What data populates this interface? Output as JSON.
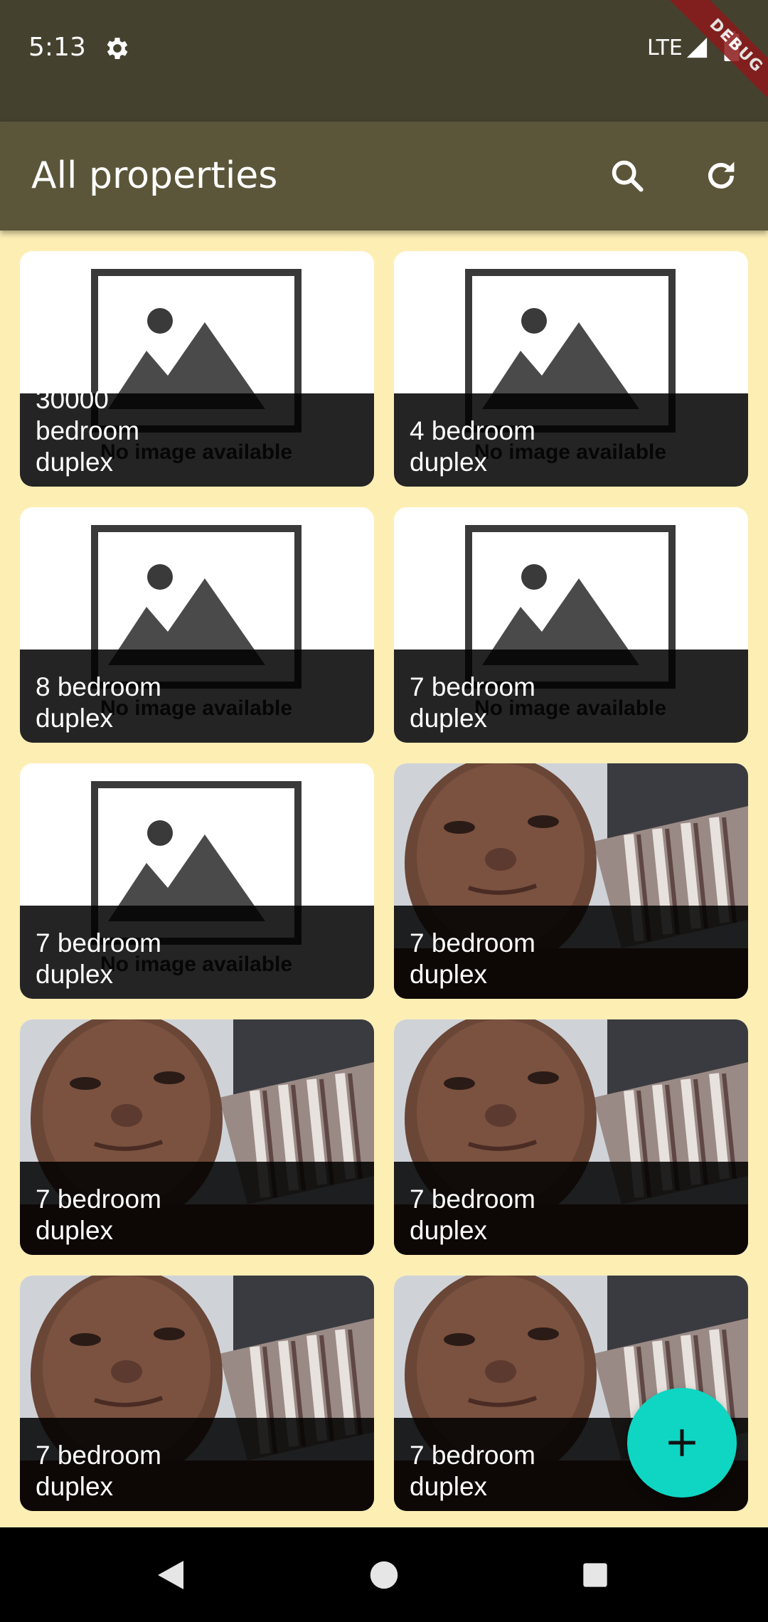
{
  "status_bar": {
    "time": "5:13",
    "network": "LTE",
    "debug_label": "DEBUG"
  },
  "app_bar": {
    "title": "All properties",
    "icons": [
      "search-icon",
      "refresh-icon"
    ]
  },
  "placeholder_text": "No image available",
  "properties": [
    {
      "title": "30000 bedroom duplex",
      "image": "placeholder"
    },
    {
      "title": "4 bedroom duplex",
      "image": "placeholder"
    },
    {
      "title": "8 bedroom duplex",
      "image": "placeholder"
    },
    {
      "title": "7 bedroom duplex",
      "image": "placeholder"
    },
    {
      "title": "7 bedroom duplex",
      "image": "placeholder"
    },
    {
      "title": "7 bedroom duplex",
      "image": "photo"
    },
    {
      "title": "7 bedroom duplex",
      "image": "photo"
    },
    {
      "title": "7 bedroom duplex",
      "image": "photo"
    },
    {
      "title": "7 bedroom duplex",
      "image": "photo"
    },
    {
      "title": "7 bedroom duplex",
      "image": "photo"
    }
  ],
  "fab": {
    "icon": "plus-icon"
  },
  "nav": {
    "buttons": [
      "back-icon",
      "home-icon",
      "recents-icon"
    ]
  },
  "colors": {
    "background": "#fdeeb4",
    "status_bar": "#45412f",
    "app_bar": "#5b5639",
    "fab": "#0fd6c3"
  }
}
